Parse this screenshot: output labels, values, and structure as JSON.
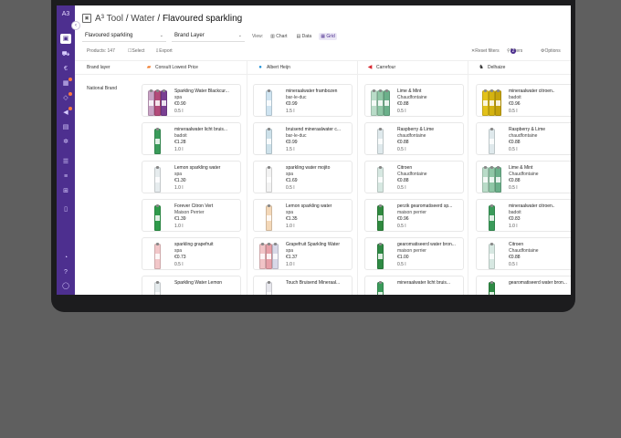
{
  "app": {
    "logo_text": "A3"
  },
  "title": {
    "tool": "A³ Tool",
    "sep1": " / ",
    "category": "Water",
    "sep2": " / ",
    "current": "Flavoured sparkling"
  },
  "toolbar": {
    "category_select": "Flavoured sparkling",
    "layer_select": "Brand Layer",
    "view_label": "View:",
    "view_chart": "Chart",
    "view_data": "Data",
    "view_grid": "Grid"
  },
  "subbar": {
    "products": "Products: 147",
    "select": "Select",
    "export": "Export",
    "reset_filters": "Reset filters",
    "filters": "Filters",
    "filters_count": "2",
    "options": "Options"
  },
  "table": {
    "brand_layer_header": "Brand layer",
    "row_label": "National Brand",
    "columns": [
      {
        "name": "Consult Lowest Price",
        "icon": "colruyt-logo-icon",
        "color": "#f07a2a"
      },
      {
        "name": "Albert Heijn",
        "icon": "albert-heijn-logo-icon",
        "color": "#1a8fd8"
      },
      {
        "name": "Carrefour",
        "icon": "carrefour-logo-icon",
        "color": "#1e4aa8"
      },
      {
        "name": "Delhaize",
        "icon": "delhaize-logo-icon",
        "color": "#333333"
      }
    ],
    "products": [
      [
        {
          "name": "Sparkling Water Blackcur...",
          "brand": "spa",
          "price": "€0.90",
          "volume": "0.5 l",
          "colors": [
            "#c9a3c5",
            "#b34b7a",
            "#7a3f93"
          ],
          "multi": true
        },
        {
          "name": "mineraalwater licht bruis...",
          "brand": "badoit",
          "price": "€1.28",
          "volume": "1.0 l",
          "colors": [
            "#3a9b5a"
          ],
          "multi": false
        },
        {
          "name": "Lemon sparkling water",
          "brand": "spa",
          "price": "€1.30",
          "volume": "1.0 l",
          "colors": [
            "#e6ecee"
          ],
          "multi": false
        },
        {
          "name": "Forever Citron Vert",
          "brand": "Maison Perrier",
          "price": "€1.39",
          "volume": "1.0 l",
          "colors": [
            "#2e9a4a"
          ],
          "multi": false
        },
        {
          "name": "sparkling grapefruit",
          "brand": "spa",
          "price": "€0.73",
          "volume": "0.5 l",
          "colors": [
            "#f2c7c9"
          ],
          "multi": false
        },
        {
          "name": "Sparkling Water Lemon",
          "brand": "",
          "price": "",
          "volume": "",
          "colors": [
            "#e6ecee"
          ],
          "multi": false
        }
      ],
      [
        {
          "name": "mineraalwater frambozen",
          "brand": "bar-le-duc",
          "price": "€0.99",
          "volume": "1.5 l",
          "colors": [
            "#cfe4f1"
          ],
          "multi": false
        },
        {
          "name": "bruisend mineraalwater c...",
          "brand": "bar-le-duc",
          "price": "€0.99",
          "volume": "1.5 l",
          "colors": [
            "#cde1ea"
          ],
          "multi": false
        },
        {
          "name": "sparkling water mojito",
          "brand": "spa",
          "price": "€1.69",
          "volume": "0.5 l",
          "colors": [
            "#f3f3f3"
          ],
          "multi": false
        },
        {
          "name": "Lemon sparkling water",
          "brand": "spa",
          "price": "€1.35",
          "volume": "1.0 l",
          "colors": [
            "#f4d8b8"
          ],
          "multi": false
        },
        {
          "name": "Grapefruit Sparkling Water",
          "brand": "spa",
          "price": "€1.37",
          "volume": "1.0 l",
          "colors": [
            "#f1c4c7",
            "#e7a0a8",
            "#d8d8e8"
          ],
          "multi": true
        },
        {
          "name": "Touch Bruisend Mineraal...",
          "brand": "",
          "price": "",
          "volume": "",
          "colors": [
            "#e8e8ee"
          ],
          "multi": false
        }
      ],
      [
        {
          "name": "Lime & Mint",
          "brand": "Chaudfontaine",
          "price": "€0.88",
          "volume": "0.5 l",
          "colors": [
            "#b9dcc8",
            "#8fc7a6",
            "#6bb08a"
          ],
          "multi": true
        },
        {
          "name": "Raspberry & Lime",
          "brand": "chaudfontaine",
          "price": "€0.88",
          "volume": "0.5 l",
          "colors": [
            "#dfe9ec"
          ],
          "multi": false
        },
        {
          "name": "Citroen",
          "brand": "Chaudfontaine",
          "price": "€0.88",
          "volume": "0.5 l",
          "colors": [
            "#d7e8e2"
          ],
          "multi": false
        },
        {
          "name": "perzik gearomatiseerd sp...",
          "brand": "maison perrier",
          "price": "€0.96",
          "volume": "0.5 l",
          "colors": [
            "#2f8a3f"
          ],
          "multi": false
        },
        {
          "name": "gearomatiseerd water bron...",
          "brand": "maison perrier",
          "price": "€1.00",
          "volume": "0.5 l",
          "colors": [
            "#2e8a44"
          ],
          "multi": false
        },
        {
          "name": "mineraalwater licht bruis...",
          "brand": "",
          "price": "",
          "volume": "",
          "colors": [
            "#3a9b5a"
          ],
          "multi": false
        }
      ],
      [
        {
          "name": "mineraalwater citroen..",
          "brand": "badoit",
          "price": "€0.96",
          "volume": "0.5 l",
          "colors": [
            "#e3c21a",
            "#d4b311",
            "#c6a40c"
          ],
          "multi": true
        },
        {
          "name": "Raspberry & Lime",
          "brand": "chaudfontaine",
          "price": "€0.88",
          "volume": "0.5 l",
          "colors": [
            "#dfe9ec"
          ],
          "multi": false
        },
        {
          "name": "Lime & Mint",
          "brand": "Chaudfontaine",
          "price": "€0.88",
          "volume": "0.5 l",
          "colors": [
            "#b9dcc8",
            "#8fc7a6",
            "#6bb08a"
          ],
          "multi": true
        },
        {
          "name": "mineraalwater citroen..",
          "brand": "badoit",
          "price": "€0.83",
          "volume": "1.0 l",
          "colors": [
            "#3a9b5a"
          ],
          "multi": false
        },
        {
          "name": "Citroen",
          "brand": "Chaudfontaine",
          "price": "€0.88",
          "volume": "0.5 l",
          "colors": [
            "#d7e8e2"
          ],
          "multi": false
        },
        {
          "name": "gearomatiseerd water bron...",
          "brand": "",
          "price": "",
          "volume": "",
          "colors": [
            "#2e8a44"
          ],
          "multi": false
        }
      ]
    ]
  }
}
